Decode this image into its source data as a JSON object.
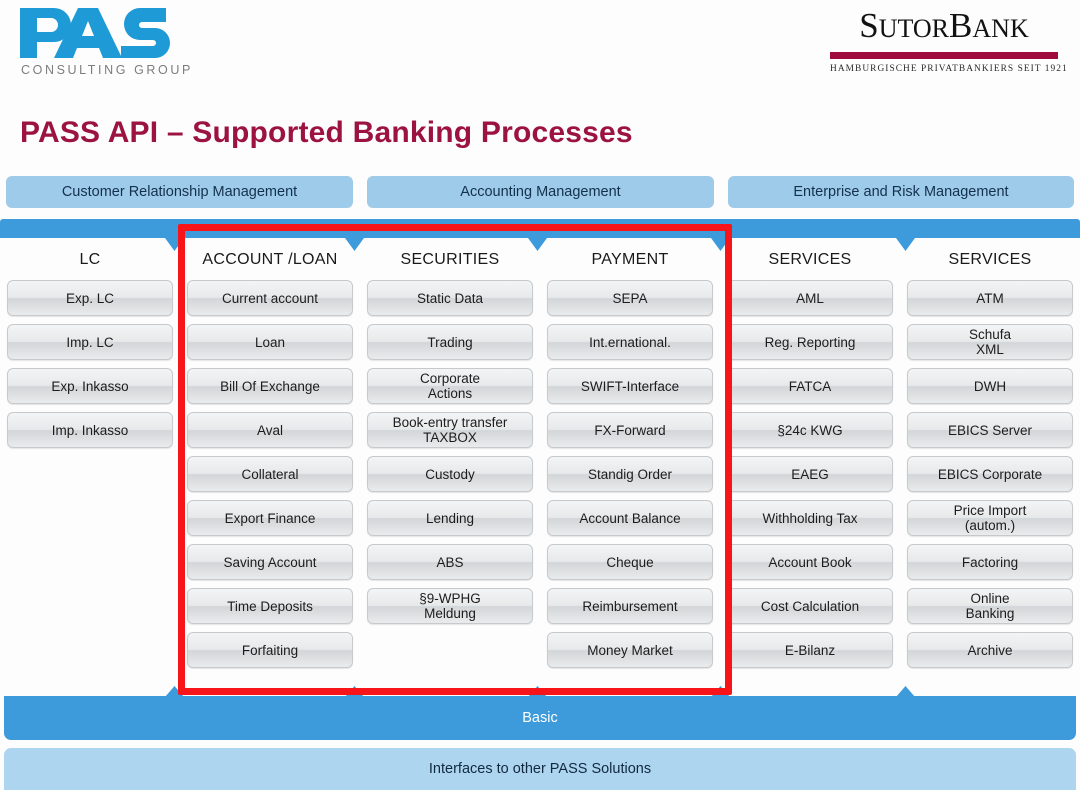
{
  "logos": {
    "pass": {
      "name": "PASS",
      "tagline": "CONSULTING GROUP",
      "color": "#1e9bd7"
    },
    "sutor": {
      "word_part1": "S",
      "word_part2": "UTOR",
      "word_part3": "B",
      "word_part4": "ANK",
      "subtitle": "HAMBURGISCHE PRIVATBANKIERS SEIT 1921",
      "rule_color": "#9e0b3c"
    }
  },
  "title": "PASS API – Supported Banking Processes",
  "title_color": "#9c1241",
  "categories": [
    {
      "label": "Customer Relationship Management"
    },
    {
      "label": "Accounting  Management"
    },
    {
      "label": "Enterprise  and  Risk Management"
    }
  ],
  "columns": [
    {
      "header": "LC",
      "items": [
        "Exp. LC",
        "Imp. LC",
        "Exp. Inkasso",
        "Imp. Inkasso",
        "",
        "",
        "",
        "",
        ""
      ]
    },
    {
      "header": "ACCOUNT  /LOAN",
      "items": [
        "Current account",
        "Loan",
        "Bill Of Exchange",
        "Aval",
        "Collateral",
        "Export Finance",
        "Saving Account",
        "Time Deposits",
        "Forfaiting"
      ]
    },
    {
      "header": "SECURITIES",
      "items": [
        "Static Data",
        "Trading",
        "Corporate\nActions",
        "Book-entry transfer\nTAXBOX",
        "Custody",
        "Lending",
        "ABS",
        "§9-WPHG\nMeldung",
        ""
      ]
    },
    {
      "header": "PAYMENT",
      "items": [
        "SEPA",
        "Int.ernational.",
        "SWIFT-Interface",
        "FX-Forward",
        "Standig Order",
        "Account Balance",
        "Cheque",
        "Reimbursement",
        "Money Market"
      ]
    },
    {
      "header": "SERVICES",
      "items": [
        "AML",
        "Reg. Reporting",
        "FATCA",
        "§24c KWG",
        "EAEG",
        "Withholding Tax",
        "Account Book",
        "Cost Calculation",
        "E-Bilanz"
      ]
    },
    {
      "header": "SERVICES",
      "items": [
        "ATM",
        "Schufa\nXML",
        "DWH",
        "EBICS Server",
        "EBICS Corporate",
        "Price Import\n(autom.)",
        "Factoring",
        "Online\nBanking",
        "Archive"
      ]
    }
  ],
  "highlight": {
    "color": "#f8151a",
    "covers": [
      "ACCOUNT  /LOAN",
      "SECURITIES",
      "PAYMENT"
    ]
  },
  "bottom": {
    "basic_label": "Basic",
    "basic_color": "#3d9bdb",
    "interfaces_label": "Interfaces  to other  PASS  Solutions",
    "interfaces_color": "#aed5ef"
  }
}
